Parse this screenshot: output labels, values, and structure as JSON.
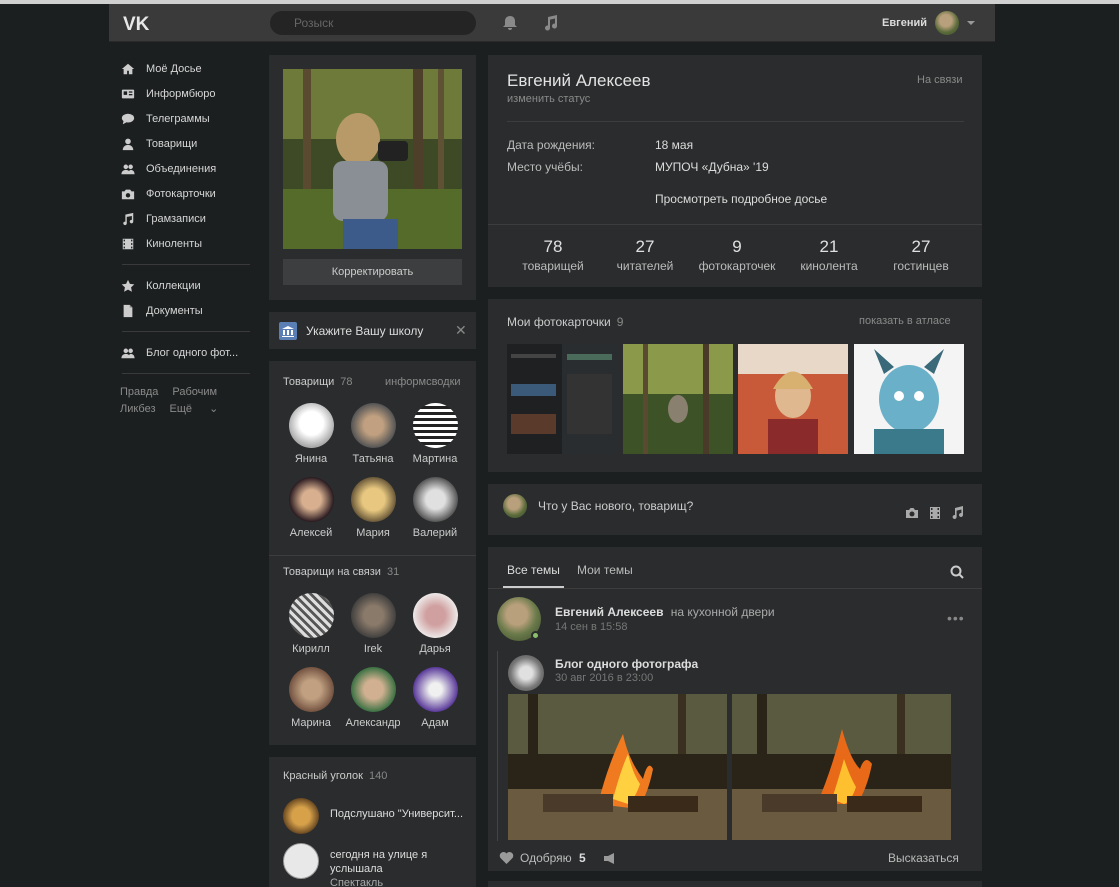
{
  "topbar": {
    "search_placeholder": "Розыск",
    "user_name": "Евгений",
    "icons": [
      "vk-logo",
      "bell-icon",
      "music-icon",
      "avatar",
      "chevron-down-icon"
    ]
  },
  "nav": {
    "items": [
      {
        "label": "Моё Досье",
        "icon": "home-icon"
      },
      {
        "label": "Информбюро",
        "icon": "news-icon"
      },
      {
        "label": "Телеграммы",
        "icon": "message-icon"
      },
      {
        "label": "Товарищи",
        "icon": "user-icon"
      },
      {
        "label": "Объединения",
        "icon": "users-icon"
      },
      {
        "label": "Фотокарточки",
        "icon": "camera-icon"
      },
      {
        "label": "Грамзаписи",
        "icon": "music-icon"
      },
      {
        "label": "Киноленты",
        "icon": "film-icon"
      }
    ],
    "items2": [
      {
        "label": "Коллекции",
        "icon": "star-icon"
      },
      {
        "label": "Документы",
        "icon": "document-icon"
      }
    ],
    "items3": [
      {
        "label": "Блог одного фот...",
        "icon": "group-icon"
      }
    ],
    "footer": [
      "Правда",
      "Рабочим",
      "Ликбез",
      "Ещё"
    ]
  },
  "profile": {
    "edit_button": "Корректировать",
    "name": "Евгений Алексеев",
    "status_link": "изменить статус",
    "online": "На связи",
    "birthday_label": "Дата рождения:",
    "birthday_value": "18 мая",
    "study_label": "Место учёбы:",
    "study_value": "МУПОЧ «Дубна» '19",
    "more_link": "Просмотреть подробное досье",
    "stats": [
      {
        "num": "78",
        "label": "товарищей"
      },
      {
        "num": "27",
        "label": "читателей"
      },
      {
        "num": "9",
        "label": "фотокарточек"
      },
      {
        "num": "21",
        "label": "кинолента"
      },
      {
        "num": "27",
        "label": "гостинцев"
      }
    ]
  },
  "school": {
    "text": "Укажите Вашу школу"
  },
  "friends": {
    "title": "Товарищи",
    "count": "78",
    "link": "информсводки",
    "people": [
      "Янина",
      "Татьяна",
      "Мартина",
      "Алексей",
      "Мария",
      "Валерий"
    ]
  },
  "online_friends": {
    "title": "Товарищи на связи",
    "count": "31",
    "people": [
      "Кирилл",
      "Irek",
      "Дарья",
      "Марина",
      "Александр",
      "Адам"
    ]
  },
  "groups": {
    "title": "Красный уголок",
    "count": "140",
    "items": [
      {
        "title": "Подслушано \"Университ..."
      },
      {
        "title": "сегодня на улице я услышала",
        "sub": "Спектакль"
      }
    ]
  },
  "photos": {
    "title": "Мои фотокарточки",
    "count": "9",
    "link": "показать в атласе"
  },
  "composer": {
    "placeholder": "Что у Вас нового, товарищ?"
  },
  "wall": {
    "tabs": [
      "Все темы",
      "Мои темы"
    ],
    "post": {
      "author": "Евгений Алексеев",
      "action": "на кухонной двери",
      "time": "14 сен в 15:58",
      "repost_author": "Блог одного фотографа",
      "repost_time": "30 авг 2016 в 23:00",
      "like_label": "Одобряю",
      "like_count": "5",
      "comment_label": "Высказаться"
    }
  },
  "colors": {
    "background": "#1b1f20",
    "card": "#2a2c2d",
    "topbar": "#3a3a3a"
  }
}
